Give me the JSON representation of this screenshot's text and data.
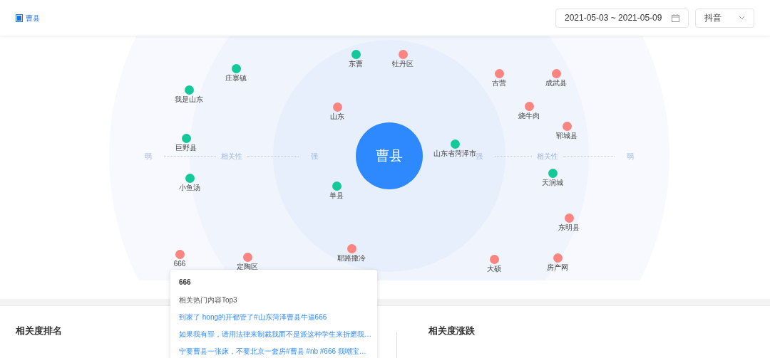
{
  "header": {
    "title": "曹县",
    "date_range": "2021-05-03 ~ 2021-05-09",
    "platform": "抖音"
  },
  "graph": {
    "center": "曹县",
    "axis_left": [
      "弱",
      "相关性",
      "强"
    ],
    "axis_right": [
      "强",
      "相关性",
      "弱"
    ],
    "nodes": [
      {
        "label": "东曹",
        "color": "#13c99a"
      },
      {
        "label": "牡丹区",
        "color": "#fa8480"
      },
      {
        "label": "庄寨镇",
        "color": "#13c99a"
      },
      {
        "label": "古营",
        "color": "#fa8480"
      },
      {
        "label": "成武县",
        "color": "#fa8480"
      },
      {
        "label": "我是山东",
        "color": "#13c99a"
      },
      {
        "label": "山东",
        "color": "#fa8480"
      },
      {
        "label": "烧牛肉",
        "color": "#fa8480"
      },
      {
        "label": "郓城县",
        "color": "#fa8480"
      },
      {
        "label": "巨野县",
        "color": "#13c99a"
      },
      {
        "label": "山东省菏泽市",
        "color": "#13c99a"
      },
      {
        "label": "天润城",
        "color": "#13c99a"
      },
      {
        "label": "小鱼汤",
        "color": "#13c99a"
      },
      {
        "label": "单县",
        "color": "#13c99a"
      },
      {
        "label": "东明县",
        "color": "#fa8480"
      },
      {
        "label": "耶路撒冷",
        "color": "#fa8480"
      },
      {
        "label": "666",
        "color": "#fa8480"
      },
      {
        "label": "定陶区",
        "color": "#fa8480"
      },
      {
        "label": "大硕",
        "color": "#fa8480"
      },
      {
        "label": "房产网",
        "color": "#fa8480"
      }
    ]
  },
  "tooltip": {
    "title": "666",
    "subtitle": "相关热门内容Top3",
    "links": [
      "到家了 hong的开都管了#山东菏泽曹县牛逼666",
      "如果我有罪，请用法律来制裁我而不是派这种学生来折磨我…",
      "宁要曹县一张床，不要北京一套房#曹县 #nb #666 我嘲宝…"
    ]
  },
  "sections": [
    "相关度排名",
    "相关度涨跌"
  ]
}
